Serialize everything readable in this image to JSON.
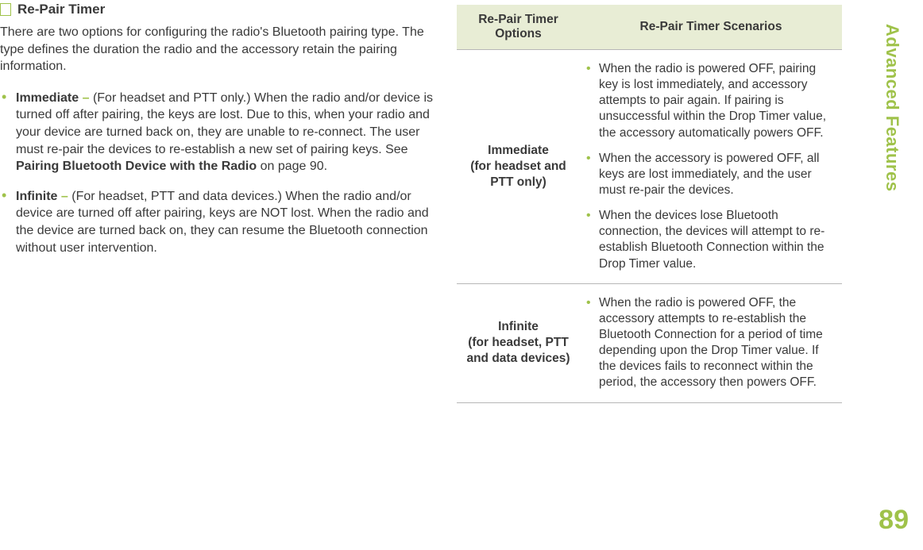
{
  "side_title": "Advanced Features",
  "page_number": "89",
  "section": {
    "title": "Re-Pair Timer",
    "intro": "There are two options for configuring the radio's Bluetooth pairing type. The type defines the duration the radio and the accessory retain the pairing information.",
    "bullets": [
      {
        "lead": "Immediate",
        "dash": "–",
        "body_a": " (For headset and PTT only.) When the radio and/or device is turned off after pairing, the keys are lost. Due to this, when your radio and your device are turned back on, they are unable to re-connect. The user must re-pair the devices to re-establish a new set of pairing keys. See ",
        "ref": "Pairing Bluetooth Device with the Radio",
        "body_b": " on page 90."
      },
      {
        "lead": "Infinite",
        "dash": "–",
        "body_a": " (For headset, PTT and data devices.) When the radio and/or device are turned off after pairing, keys are NOT lost. When the radio and the device are turned back on, they can resume the Bluetooth connection without user intervention.",
        "ref": "",
        "body_b": ""
      }
    ]
  },
  "table": {
    "headers": {
      "options": "Re-Pair Timer Options",
      "scenarios": "Re-Pair Timer Scenarios"
    },
    "rows": [
      {
        "option_main": "Immediate",
        "option_sub": "(for headset and PTT only)",
        "items": [
          "When the radio is powered OFF, pairing key is lost immediately, and accessory attempts to pair again. If pairing is unsuccessful within the Drop Timer value, the accessory automatically powers OFF.",
          "When the accessory is powered OFF, all keys are lost immediately, and the user must re-pair the devices.",
          "When the devices lose Bluetooth connection, the devices will attempt to re-establish Bluetooth Connection within the Drop Timer value."
        ]
      },
      {
        "option_main": "Infinite",
        "option_sub": "(for headset, PTT and data devices)",
        "items": [
          "When the radio is powered OFF, the accessory attempts to re-establish the Bluetooth Connection for a period of time depending upon the Drop Timer value. If the devices fails to reconnect within the period, the accessory then powers OFF."
        ]
      }
    ]
  }
}
